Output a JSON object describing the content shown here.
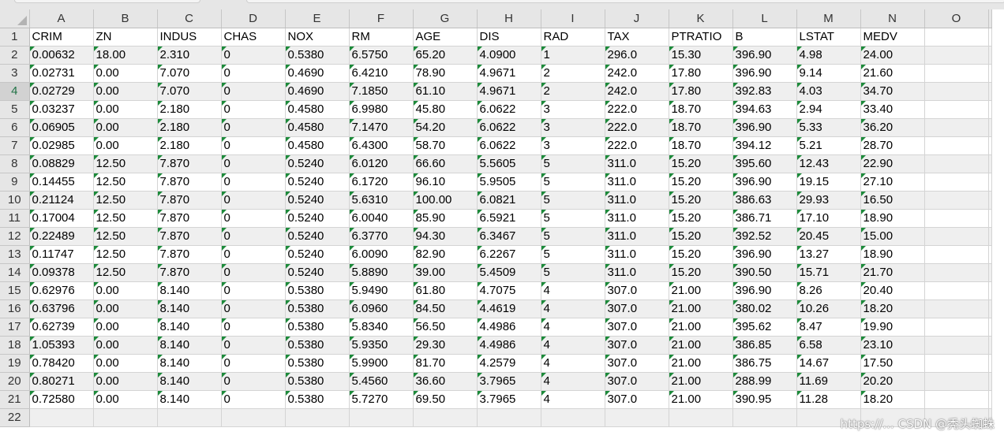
{
  "columns": [
    "A",
    "B",
    "C",
    "D",
    "E",
    "F",
    "G",
    "H",
    "I",
    "J",
    "K",
    "L",
    "M",
    "N",
    "O"
  ],
  "rows": [
    [
      "CRIM",
      "ZN",
      "INDUS",
      "CHAS",
      "NOX",
      "RM",
      "AGE",
      "DIS",
      "RAD",
      "TAX",
      "PTRATIO",
      "B",
      "LSTAT",
      "MEDV"
    ],
    [
      "0.00632",
      "18.00",
      "2.310",
      "0",
      "0.5380",
      "6.5750",
      "65.20",
      "4.0900",
      "1",
      "296.0",
      "15.30",
      "396.90",
      "4.98",
      "24.00"
    ],
    [
      "0.02731",
      "0.00",
      "7.070",
      "0",
      "0.4690",
      "6.4210",
      "78.90",
      "4.9671",
      "2",
      "242.0",
      "17.80",
      "396.90",
      "9.14",
      "21.60"
    ],
    [
      "0.02729",
      "0.00",
      "7.070",
      "0",
      "0.4690",
      "7.1850",
      "61.10",
      "4.9671",
      "2",
      "242.0",
      "17.80",
      "392.83",
      "4.03",
      "34.70"
    ],
    [
      "0.03237",
      "0.00",
      "2.180",
      "0",
      "0.4580",
      "6.9980",
      "45.80",
      "6.0622",
      "3",
      "222.0",
      "18.70",
      "394.63",
      "2.94",
      "33.40"
    ],
    [
      "0.06905",
      "0.00",
      "2.180",
      "0",
      "0.4580",
      "7.1470",
      "54.20",
      "6.0622",
      "3",
      "222.0",
      "18.70",
      "396.90",
      "5.33",
      "36.20"
    ],
    [
      "0.02985",
      "0.00",
      "2.180",
      "0",
      "0.4580",
      "6.4300",
      "58.70",
      "6.0622",
      "3",
      "222.0",
      "18.70",
      "394.12",
      "5.21",
      "28.70"
    ],
    [
      "0.08829",
      "12.50",
      "7.870",
      "0",
      "0.5240",
      "6.0120",
      "66.60",
      "5.5605",
      "5",
      "311.0",
      "15.20",
      "395.60",
      "12.43",
      "22.90"
    ],
    [
      "0.14455",
      "12.50",
      "7.870",
      "0",
      "0.5240",
      "6.1720",
      "96.10",
      "5.9505",
      "5",
      "311.0",
      "15.20",
      "396.90",
      "19.15",
      "27.10"
    ],
    [
      "0.21124",
      "12.50",
      "7.870",
      "0",
      "0.5240",
      "5.6310",
      "100.00",
      "6.0821",
      "5",
      "311.0",
      "15.20",
      "386.63",
      "29.93",
      "16.50"
    ],
    [
      "0.17004",
      "12.50",
      "7.870",
      "0",
      "0.5240",
      "6.0040",
      "85.90",
      "6.5921",
      "5",
      "311.0",
      "15.20",
      "386.71",
      "17.10",
      "18.90"
    ],
    [
      "0.22489",
      "12.50",
      "7.870",
      "0",
      "0.5240",
      "6.3770",
      "94.30",
      "6.3467",
      "5",
      "311.0",
      "15.20",
      "392.52",
      "20.45",
      "15.00"
    ],
    [
      "0.11747",
      "12.50",
      "7.870",
      "0",
      "0.5240",
      "6.0090",
      "82.90",
      "6.2267",
      "5",
      "311.0",
      "15.20",
      "396.90",
      "13.27",
      "18.90"
    ],
    [
      "0.09378",
      "12.50",
      "7.870",
      "0",
      "0.5240",
      "5.8890",
      "39.00",
      "5.4509",
      "5",
      "311.0",
      "15.20",
      "390.50",
      "15.71",
      "21.70"
    ],
    [
      "0.62976",
      "0.00",
      "8.140",
      "0",
      "0.5380",
      "5.9490",
      "61.80",
      "4.7075",
      "4",
      "307.0",
      "21.00",
      "396.90",
      "8.26",
      "20.40"
    ],
    [
      "0.63796",
      "0.00",
      "8.140",
      "0",
      "0.5380",
      "6.0960",
      "84.50",
      "4.4619",
      "4",
      "307.0",
      "21.00",
      "380.02",
      "10.26",
      "18.20"
    ],
    [
      "0.62739",
      "0.00",
      "8.140",
      "0",
      "0.5380",
      "5.8340",
      "56.50",
      "4.4986",
      "4",
      "307.0",
      "21.00",
      "395.62",
      "8.47",
      "19.90"
    ],
    [
      "1.05393",
      "0.00",
      "8.140",
      "0",
      "0.5380",
      "5.9350",
      "29.30",
      "4.4986",
      "4",
      "307.0",
      "21.00",
      "386.85",
      "6.58",
      "23.10"
    ],
    [
      "0.78420",
      "0.00",
      "8.140",
      "0",
      "0.5380",
      "5.9900",
      "81.70",
      "4.2579",
      "4",
      "307.0",
      "21.00",
      "386.75",
      "14.67",
      "17.50"
    ],
    [
      "0.80271",
      "0.00",
      "8.140",
      "0",
      "0.5380",
      "5.4560",
      "36.60",
      "3.7965",
      "4",
      "307.0",
      "21.00",
      "288.99",
      "11.69",
      "20.20"
    ],
    [
      "0.72580",
      "0.00",
      "8.140",
      "0",
      "0.5380",
      "5.7270",
      "69.50",
      "3.7965",
      "4",
      "307.0",
      "21.00",
      "390.95",
      "11.28",
      "18.20"
    ]
  ],
  "total_rows_shown": 22,
  "active_row": 4,
  "colors": {
    "header_bg": "#e6e6e6",
    "alt_row_bg": "#efefef",
    "gridline": "#d4d4d4",
    "error_indicator": "#1c8a3a",
    "active_header_text": "#217346"
  },
  "watermark": "https://... CSDN @秃头蜘蛛"
}
